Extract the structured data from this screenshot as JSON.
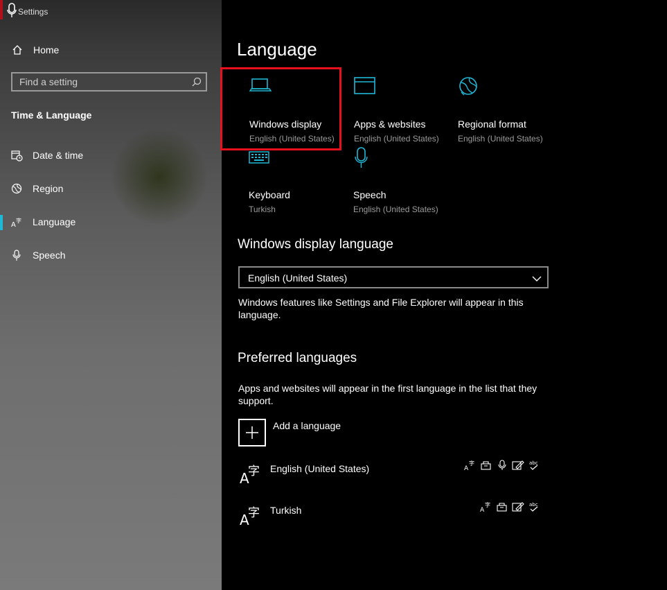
{
  "window": {
    "title": "Settings"
  },
  "sidebar": {
    "home_label": "Home",
    "search_placeholder": "Find a setting",
    "section_heading": "Time & Language",
    "items": [
      {
        "label": "Date & time",
        "icon": "calendar-clock-icon"
      },
      {
        "label": "Region",
        "icon": "globe-icon"
      },
      {
        "label": "Language",
        "icon": "language-icon",
        "active": true
      },
      {
        "label": "Speech",
        "icon": "microphone-icon"
      }
    ]
  },
  "main": {
    "title": "Language",
    "tiles": [
      {
        "name": "Windows display",
        "sub": "English (United States)",
        "icon": "laptop-icon"
      },
      {
        "name": "Apps & websites",
        "sub": "English (United States)",
        "icon": "window-icon"
      },
      {
        "name": "Regional format",
        "sub": "English (United States)",
        "icon": "globe-icon"
      },
      {
        "name": "Keyboard",
        "sub": "Turkish",
        "icon": "keyboard-icon"
      },
      {
        "name": "Speech",
        "sub": "English (United States)",
        "icon": "microphone-icon"
      }
    ],
    "display_language": {
      "heading": "Windows display language",
      "selected": "English (United States)",
      "description": "Windows features like Settings and File Explorer will appear in this language."
    },
    "preferred": {
      "heading": "Preferred languages",
      "description": "Apps and websites will appear in the first language in the list that they support.",
      "add_label": "Add a language",
      "languages": [
        {
          "name": "English (United States)",
          "features": [
            "display-language-icon",
            "language-pack-icon",
            "speech-icon",
            "handwriting-icon",
            "spell-check-icon"
          ]
        },
        {
          "name": "Turkish",
          "features": [
            "display-language-icon",
            "language-pack-icon",
            "handwriting-icon",
            "spell-check-icon"
          ]
        }
      ]
    }
  },
  "colors": {
    "accent": "#1fb8d6",
    "highlight": "#e8101c",
    "subtext": "#9c9c9c"
  }
}
